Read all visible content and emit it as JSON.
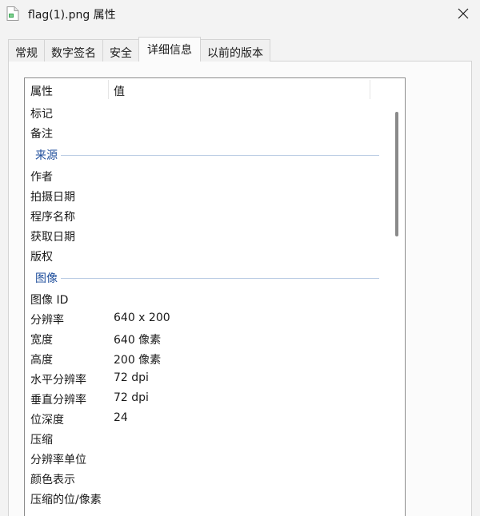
{
  "window": {
    "title": "flag(1).png 属性"
  },
  "tabs": [
    {
      "label": "常规"
    },
    {
      "label": "数字签名"
    },
    {
      "label": "安全"
    },
    {
      "label": "详细信息"
    },
    {
      "label": "以前的版本"
    }
  ],
  "active_tab": "详细信息",
  "table": {
    "col_property": "属性",
    "col_value": "值"
  },
  "rows": {
    "r0": {
      "name": "标记",
      "value": ""
    },
    "r1": {
      "name": "备注",
      "value": ""
    },
    "g_source": "来源",
    "r2": {
      "name": "作者",
      "value": ""
    },
    "r3": {
      "name": "拍摄日期",
      "value": ""
    },
    "r4": {
      "name": "程序名称",
      "value": ""
    },
    "r5": {
      "name": "获取日期",
      "value": ""
    },
    "r6": {
      "name": "版权",
      "value": ""
    },
    "g_image": "图像",
    "r7": {
      "name": "图像 ID",
      "value": ""
    },
    "r8": {
      "name": "分辨率",
      "value": "640 x 200"
    },
    "r9": {
      "name": "宽度",
      "value": "640 像素"
    },
    "r10": {
      "name": "高度",
      "value": "200 像素"
    },
    "r11": {
      "name": "水平分辨率",
      "value": "72 dpi"
    },
    "r12": {
      "name": "垂直分辨率",
      "value": "72 dpi"
    },
    "r13": {
      "name": "位深度",
      "value": "24"
    },
    "r14": {
      "name": "压缩",
      "value": ""
    },
    "r15": {
      "name": "分辨率单位",
      "value": ""
    },
    "r16": {
      "name": "颜色表示",
      "value": ""
    },
    "r17": {
      "name": "压缩的位/像素",
      "value": ""
    }
  },
  "icons": {
    "file": "png-file-icon",
    "close": "close-icon"
  },
  "colors": {
    "group_label": "#1f4e9c",
    "group_line": "#b9cbe3",
    "list_border": "#8c8c8c"
  }
}
